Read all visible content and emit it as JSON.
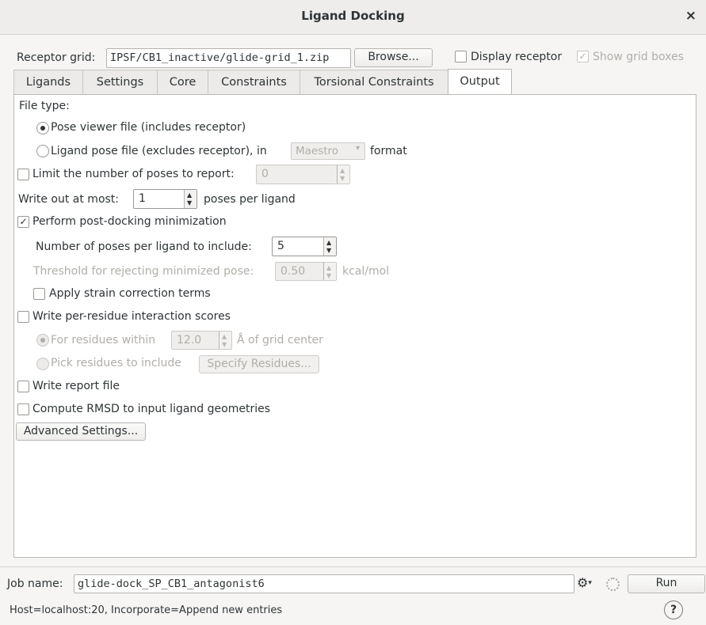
{
  "window": {
    "title": "Ligand Docking",
    "close_glyph": "×"
  },
  "receptor": {
    "label": "Receptor grid:",
    "path": "IPSF/CB1_inactive/glide-grid_1.zip",
    "browse": "Browse...",
    "display_receptor": "Display receptor",
    "show_grid_boxes": "Show grid boxes"
  },
  "tabs": [
    {
      "label": "Ligands"
    },
    {
      "label": "Settings"
    },
    {
      "label": "Core"
    },
    {
      "label": "Constraints"
    },
    {
      "label": "Torsional Constraints"
    },
    {
      "label": "Output"
    }
  ],
  "output": {
    "file_type_label": "File type:",
    "pose_viewer": "Pose viewer file (includes receptor)",
    "ligand_pose": "Ligand pose file (excludes receptor), in",
    "format_value": "Maestro",
    "format_suffix": "format",
    "limit_poses": "Limit the number of poses to report:",
    "limit_value": "0",
    "write_out_label": "Write out at most:",
    "write_out_value": "1",
    "poses_per_ligand": "poses per ligand",
    "post_dock_min": "Perform post-docking minimization",
    "num_poses_label": "Number of poses per ligand to include:",
    "num_poses_value": "5",
    "threshold_label": "Threshold for rejecting minimized pose:",
    "threshold_value": "0.50",
    "threshold_unit": "kcal/mol",
    "strain": "Apply strain correction terms",
    "per_residue": "Write per-residue interaction scores",
    "residues_within": "For residues within",
    "residues_value": "12.0",
    "residues_unit": "Å of grid center",
    "pick_residues": "Pick residues to include",
    "specify_residues": "Specify Residues...",
    "report_file": "Write report file",
    "rmsd": "Compute RMSD to input ligand geometries",
    "advanced": "Advanced Settings..."
  },
  "job": {
    "label": "Job name:",
    "value": "glide-dock_SP_CB1_antagonist6",
    "run": "Run",
    "status": "Host=localhost:20, Incorporate=Append new entries",
    "help": "?"
  },
  "check_glyph": "✓",
  "gear_glyph": "⚙"
}
